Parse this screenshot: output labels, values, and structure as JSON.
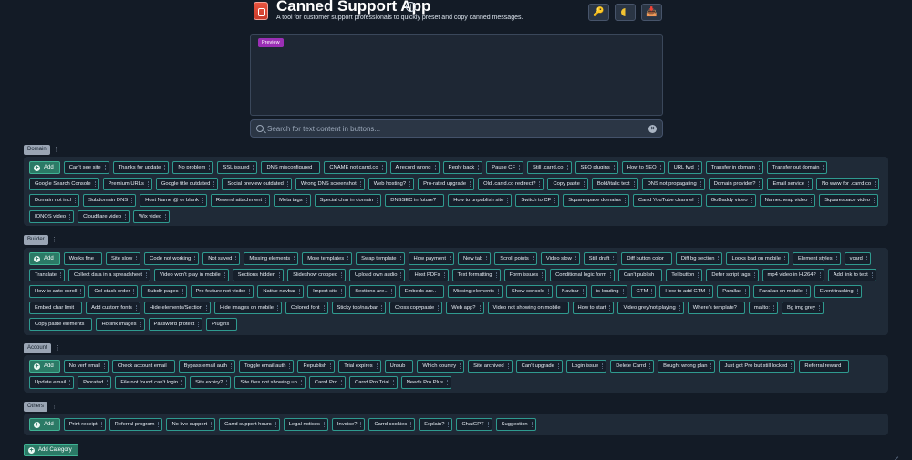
{
  "app": {
    "title": "Canned Support App",
    "subtitle": "A tool for customer support professionals to quickly preset and copy canned messages.",
    "info": "i"
  },
  "top_actions": [
    {
      "name": "key-button",
      "icon": "key-icon",
      "glyph": "🔑"
    },
    {
      "name": "theme-toggle-button",
      "icon": "half-moon-icon",
      "glyph": ""
    },
    {
      "name": "export-button",
      "icon": "tray-icon",
      "glyph": "📥"
    }
  ],
  "preview": {
    "badge": "Preview"
  },
  "search": {
    "placeholder": "Search for text content in buttons..."
  },
  "add_label": "Add",
  "add_category_label": "Add Category",
  "categories": [
    {
      "name": "Domain",
      "buttons": [
        "Can't see site",
        "Thanks for update",
        "No problem",
        "SSL issued",
        "DNS misconfigured",
        "CNAME not carrd.co",
        "A record wrong",
        "Reply back",
        "Pause CF",
        "Still .carrd.co",
        "SEO plugins",
        "How to SEO",
        "URL fwd",
        "Transfer in domain",
        "Transfer out domain",
        "Google Search Console",
        "Premium URLs",
        "Google title outdated",
        "Social preview outdated",
        "Wrong DNS screenshot",
        "Web hosting?",
        "Pro-rated upgrade",
        "Old .carrd.co redirect?",
        "Copy paste",
        "Bold/italic text",
        "DNS not propagating",
        "Domain provider?",
        "Email service",
        "No www for .carrd.co",
        "Domain not incl",
        "Subdomain DNS",
        "Host Name @ or blank",
        "Resend attachment",
        "Meta tags",
        "Special char in domain",
        "DNSSEC in future?",
        "How to unpublish site",
        "Switch to CF",
        "Squarespace domains",
        "Carrd YouTube channel",
        "GoDaddy video",
        "Namecheap video",
        "Squarespace video",
        "IONOS video",
        "Cloudflare video",
        "Wix video"
      ]
    },
    {
      "name": "Builder",
      "buttons": [
        "Works fine",
        "Site slow",
        "Code not working",
        "Not saved",
        "Missing elements",
        "More templates",
        "Swap template",
        "How payment",
        "New tab",
        "Scroll points",
        "Video slow",
        "Still draft",
        "Diff button color",
        "Diff bg section",
        "Looks bad on mobile",
        "Element styles",
        "vcard",
        "Translate",
        "Collect data in a spreadsheet",
        "Video won't play in mobile",
        "Sections hidden",
        "Slideshow cropped",
        "Upload own audio",
        "Host PDFs",
        "Text formatting",
        "Form issues",
        "Conditional logic form",
        "Can't publish",
        "Tel button",
        "Defer script tags",
        "mp4 video in H.264?",
        "Add link to text",
        "How to auto-scroll",
        "Col stack order",
        "Subdir pages",
        "Pro feature not visibe",
        "Native navbar",
        "Import site",
        "Sections are..",
        "Embeds are..",
        "Missing elements",
        "Show console",
        "Navbar",
        "is-loading",
        "GTM",
        "How to add GTM",
        "Parallax",
        "Parallax on mobile",
        "Event tracking",
        "Embed char limit",
        "Add custom fonts",
        "Hide elements/Section",
        "Hide images on mobile",
        "Colored font",
        "Sticky top/navbar",
        "Cross copypaste",
        "Web app?",
        "Video not showing on mobile",
        "How to start",
        "Video grey/not playing",
        "Where's template?",
        "mailto:",
        "Bg img grey",
        "Copy paste elements",
        "Hotlink images",
        "Password protect",
        "Plugins"
      ]
    },
    {
      "name": "Account",
      "buttons": [
        "No verf email",
        "Check account email",
        "Bypass email auth",
        "Toggle email auth",
        "Republish",
        "Trial expires",
        "Unsub",
        "Which country",
        "Site archived",
        "Can't upgrade",
        "Login issue",
        "Delete Carrd",
        "Bought wrong plan",
        "Just got Pro but still locked",
        "Referral reward",
        "Update email",
        "Prorated",
        "File not found can't login",
        "Site expiry?",
        "Site files not showing up",
        "Carrd Pro",
        "Carrd Pro Trial",
        "Needs Pro Plus"
      ]
    },
    {
      "name": "Others",
      "buttons": [
        "Print receipt",
        "Referral program",
        "No live support",
        "Carrd support hours",
        "Legal notices",
        "Invoice?",
        "Carrd cookies",
        "Explain?",
        "ChatGPT",
        "Suggestion"
      ]
    }
  ]
}
